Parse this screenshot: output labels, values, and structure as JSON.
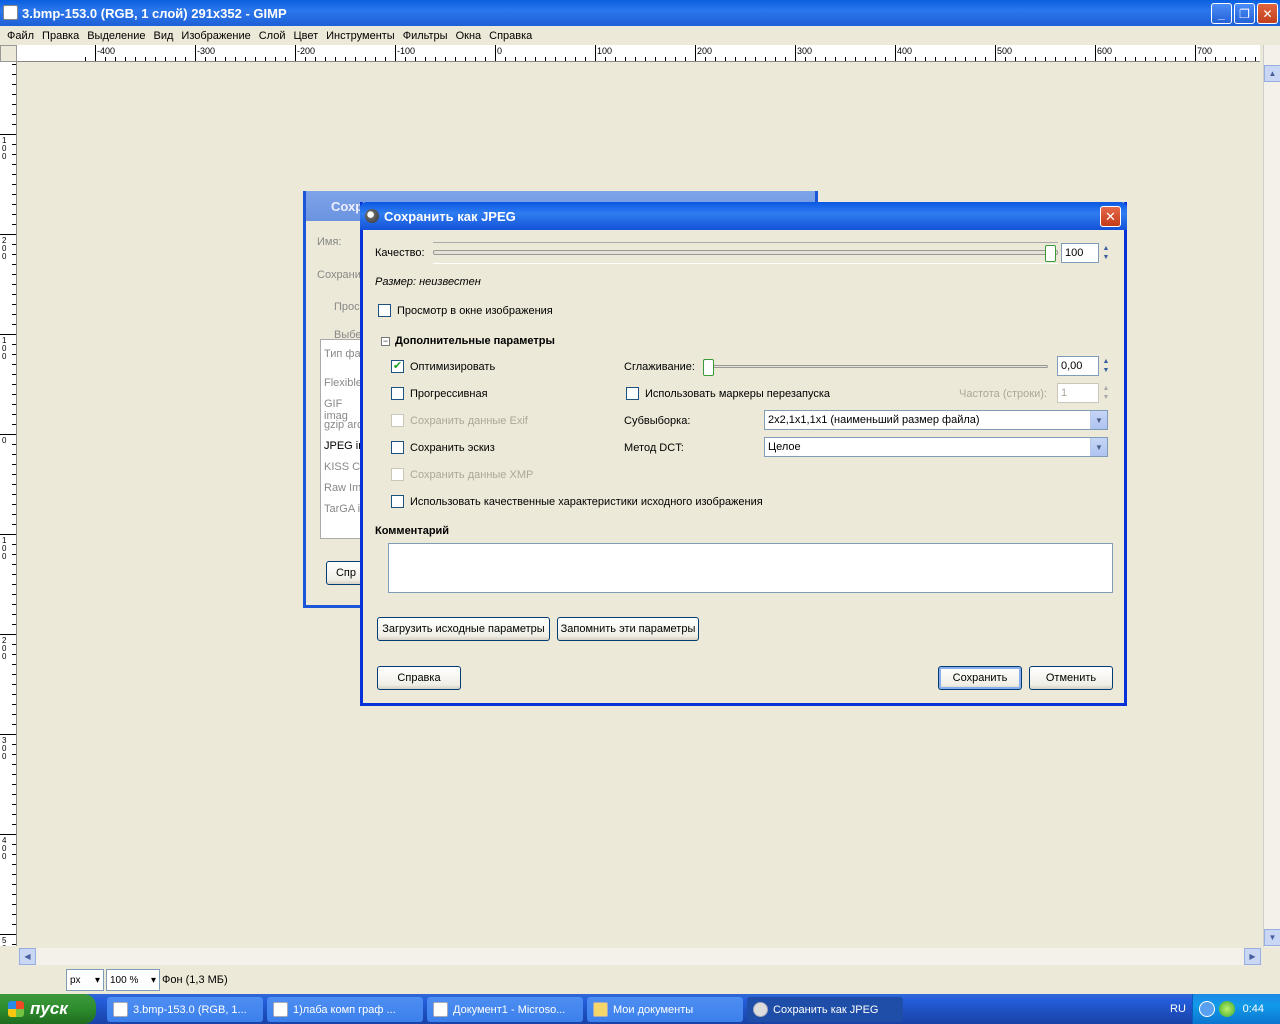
{
  "window": {
    "title": "3.bmp-153.0 (RGB, 1 слой) 291x352 - GIMP",
    "min": "_",
    "max": "❐",
    "close": "✕"
  },
  "menu": [
    "Файл",
    "Правка",
    "Выделение",
    "Вид",
    "Изображение",
    "Слой",
    "Цвет",
    "Инструменты",
    "Фильтры",
    "Окна",
    "Справка"
  ],
  "ruler": {
    "h_ticks": [
      "-400",
      "-300",
      "-200",
      "-100",
      "0",
      "100",
      "200",
      "300",
      "400",
      "500",
      "600",
      "700"
    ],
    "v_ticks": [
      "1 0 0",
      "2 0 0",
      "1 0 0",
      "0",
      "1 0 0",
      "2 0 0",
      "3 0 0",
      "4 0 0",
      "5 0 0",
      "6"
    ]
  },
  "status": {
    "unit": "px",
    "zoom": "100 %",
    "layer": "Фон (1,3 МБ)"
  },
  "bg_dialog": {
    "title": "Сохр",
    "name_label": "Имя:",
    "save_in": "Сохрани",
    "browse": "Прос",
    "select_type": "Выбе",
    "file_type_header": "Тип фа",
    "types": [
      "Flexible",
      "GIF imag",
      "gzip arc",
      "JPEG im",
      "KISS CE",
      "Raw Ima",
      "TarGA i"
    ],
    "button": "Спр"
  },
  "dialog": {
    "title": "Сохранить как JPEG",
    "close": "✕",
    "quality_label": "Качество:",
    "quality_value": "100",
    "quality_level": 1.0,
    "size_text": "Размер: неизвестен",
    "preview_label": "Просмотр в окне изображения",
    "advanced_label": "Дополнительные параметры",
    "optimize_label": "Оптимизировать",
    "optimize_check": "✔",
    "progressive_label": "Прогрессивная",
    "exif_label": "Сохранить данные Exif",
    "thumbnail_label": "Сохранить эскиз",
    "xmp_label": "Сохранить данные XMP",
    "use_quality_label": "Использовать качественные характеристики исходного изображения",
    "smoothing_label": "Сглаживание:",
    "smoothing_value": "0,00",
    "smoothing_level": 0.0,
    "restart_label": "Использовать маркеры перезапуска",
    "frequency_label": "Частота (строки):",
    "frequency_value": "1",
    "subsampling_label": "Субвыборка:",
    "subsampling_value": "2x2,1x1,1x1 (наименьший размер файла)",
    "dct_label": "Метод DCT:",
    "dct_value": "Целое",
    "comment_label": "Комментарий",
    "load_defaults": "Загрузить исходные параметры",
    "save_defaults": "Запомнить эти параметры",
    "help": "Справка",
    "save": "Сохранить",
    "cancel": "Отменить"
  },
  "taskbar": {
    "start": "пуск",
    "tasks": [
      "3.bmp-153.0 (RGB, 1...",
      "1)лаба комп граф ...",
      "Документ1 - Microso...",
      "Мои документы",
      "Сохранить как JPEG"
    ],
    "lang": "RU",
    "time": "0:44"
  }
}
